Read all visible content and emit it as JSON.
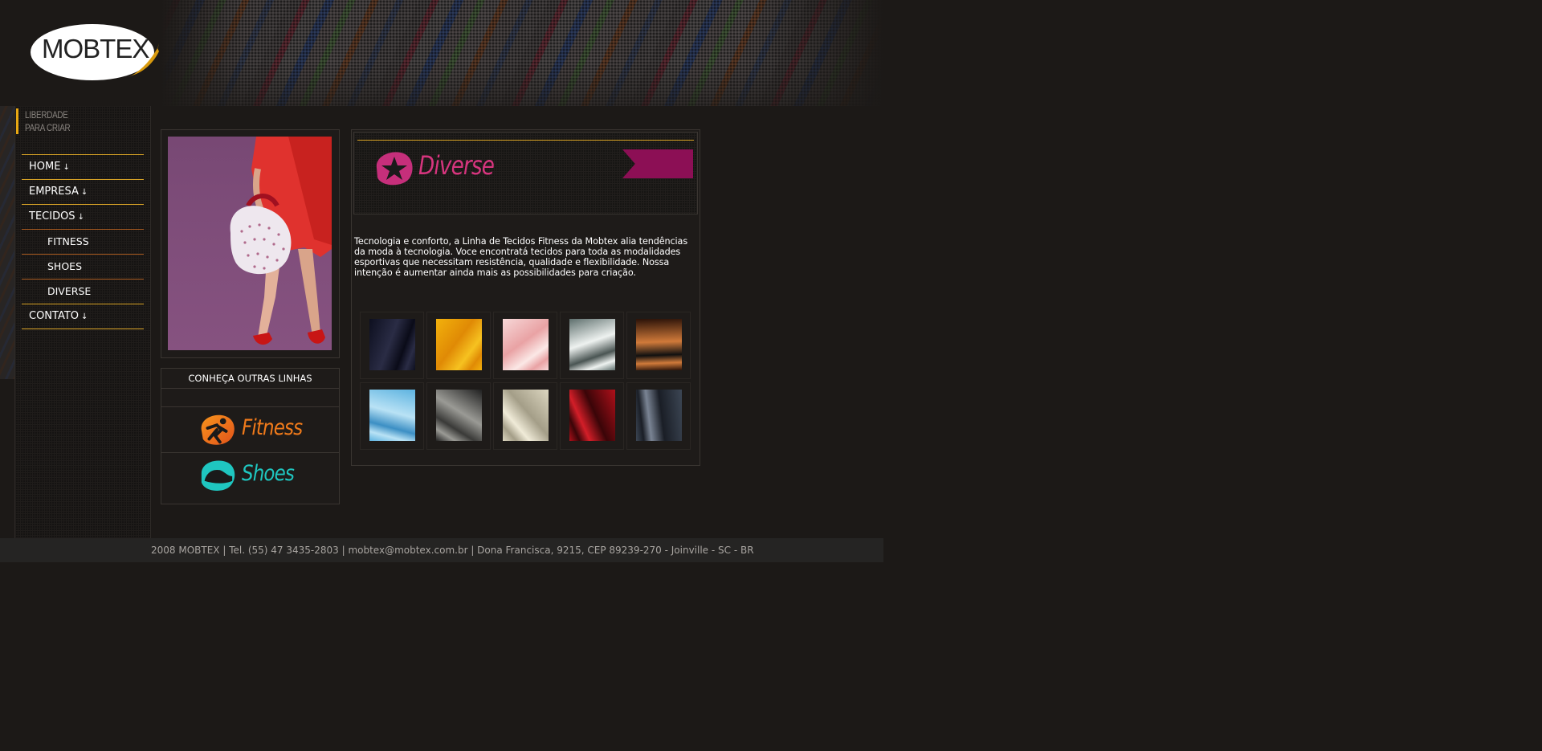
{
  "brand": {
    "logo_text": "MOBTEX",
    "tagline_line1": "LIBERDADE",
    "tagline_line2": "PARA CRIAR",
    "accent": "#e8a813"
  },
  "nav": {
    "items": [
      {
        "label": "HOME",
        "arrow": "↓",
        "sub": false
      },
      {
        "label": "EMPRESA",
        "arrow": "↓",
        "sub": false
      },
      {
        "label": "TECIDOS",
        "arrow": "↓",
        "sub": false
      },
      {
        "label": "FITNESS",
        "arrow": "",
        "sub": true
      },
      {
        "label": "SHOES",
        "arrow": "",
        "sub": true
      },
      {
        "label": "DIVERSE",
        "arrow": "",
        "sub": true
      },
      {
        "label": "CONTATO",
        "arrow": "↓",
        "sub": false
      }
    ]
  },
  "other_lines": {
    "title": "CONHEÇA OUTRAS LINHAS",
    "links": [
      {
        "label": "Fitness",
        "color": "#f07a1a",
        "icon": "runner-icon"
      },
      {
        "label": "Shoes",
        "color": "#1fc6c0",
        "icon": "shoe-icon"
      }
    ]
  },
  "section": {
    "title": "Diverse",
    "title_color": "#d6357e",
    "description": "Tecnologia e conforto, a Linha de Tecidos Fitness da Mobtex alia tendências da moda à tecnologia. Voce encontratá tecidos para toda as modalidades esportivas que necessitam resistência, qualidade e flexibilidade. Nossa intenção é aumentar ainda mais as possibilidades para criação."
  },
  "swatches": [
    {
      "name": "navy-fabric",
      "colors": [
        "#0d0f1f",
        "#2a2c45",
        "#0a0b18"
      ]
    },
    {
      "name": "yellow-fabric",
      "colors": [
        "#f2b10c",
        "#e08a05",
        "#f6c220"
      ]
    },
    {
      "name": "pink-fabric",
      "colors": [
        "#f7d8d8",
        "#e9a2a4",
        "#fbe8e6"
      ]
    },
    {
      "name": "silver-fabric",
      "colors": [
        "#5e6f6d",
        "#eef2f0",
        "#4a5553"
      ]
    },
    {
      "name": "striped-fabric",
      "colors": [
        "#2a1208",
        "#d07a3a",
        "#101010"
      ]
    },
    {
      "name": "blue-fabric",
      "colors": [
        "#5db3e0",
        "#b9e2f5",
        "#3c8fc4"
      ]
    },
    {
      "name": "snake-fabric",
      "colors": [
        "#202020",
        "#9a9a95",
        "#3a3a38"
      ]
    },
    {
      "name": "cream-fabric",
      "colors": [
        "#dcd6c0",
        "#a49e88",
        "#f0ebd8"
      ]
    },
    {
      "name": "red-fabric",
      "colors": [
        "#b0101a",
        "#3a0508",
        "#d31e28"
      ]
    },
    {
      "name": "slate-fabric",
      "colors": [
        "#3c4654",
        "#1a1e26",
        "#7a8494"
      ]
    }
  ],
  "footer": {
    "text": "2008 MOBTEX | Tel. (55) 47 3435-2803 | mobtex@mobtex.com.br | Dona Francisca, 9215, CEP 89239-270 - Joinville - SC - BR"
  }
}
